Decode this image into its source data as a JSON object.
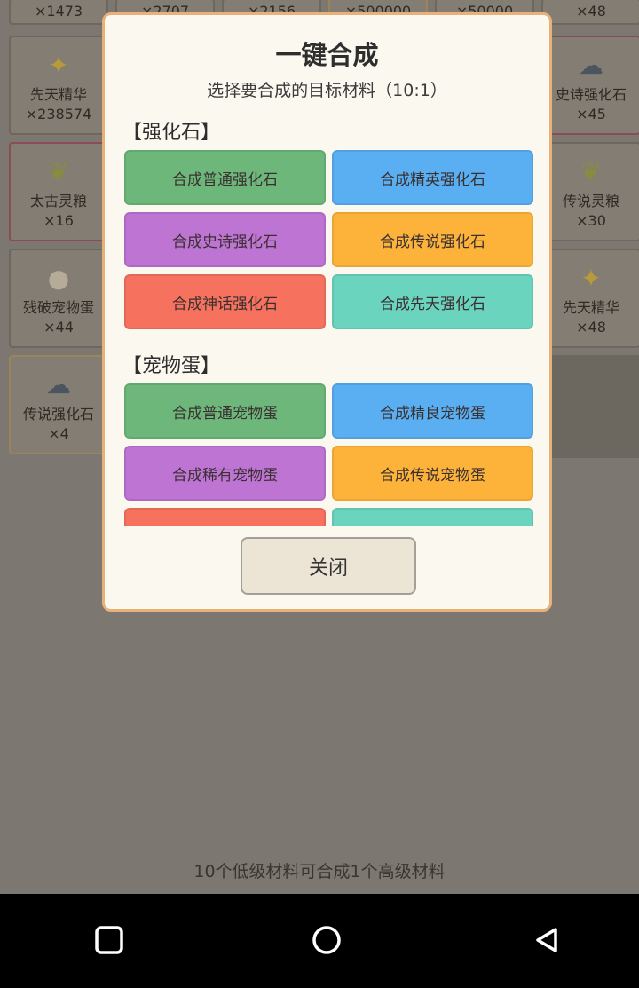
{
  "inventory": {
    "top_row": [
      "×1473",
      "×2707",
      "×2156",
      "×500000",
      "×50000",
      "×48"
    ],
    "left_items": [
      {
        "name": "先天精华",
        "count": "×238574",
        "icon": "sparkle-icon"
      },
      {
        "name": "太古灵粮",
        "count": "×16",
        "icon": "grain-icon"
      },
      {
        "name": "残破宠物蛋",
        "count": "×44",
        "icon": "egg-icon"
      },
      {
        "name": "传说强化石",
        "count": "×4",
        "icon": "stone-icon"
      }
    ],
    "right_items": [
      {
        "name": "史诗强化石",
        "count": "×45",
        "icon": "stone-icon"
      },
      {
        "name": "传说灵粮",
        "count": "×30",
        "icon": "grain-icon"
      },
      {
        "name": "先天精华",
        "count": "×48",
        "icon": "sparkle-icon"
      }
    ],
    "note": "10个低级材料可合成1个高级材料"
  },
  "dialog": {
    "title": "一键合成",
    "subtitle": "选择要合成的目标材料（10:1）",
    "sections": [
      {
        "title": "【强化石】",
        "buttons": [
          {
            "label": "合成普通强化石",
            "color": "#6db77b"
          },
          {
            "label": "合成精英强化石",
            "color": "#5aaef2"
          },
          {
            "label": "合成史诗强化石",
            "color": "#bd74d3"
          },
          {
            "label": "合成传说强化石",
            "color": "#fdb33a"
          },
          {
            "label": "合成神话强化石",
            "color": "#f6725f"
          },
          {
            "label": "合成先天强化石",
            "color": "#6bd4bf"
          }
        ]
      },
      {
        "title": "【宠物蛋】",
        "buttons": [
          {
            "label": "合成普通宠物蛋",
            "color": "#6db77b"
          },
          {
            "label": "合成精良宠物蛋",
            "color": "#5aaef2"
          },
          {
            "label": "合成稀有宠物蛋",
            "color": "#bd74d3"
          },
          {
            "label": "合成传说宠物蛋",
            "color": "#fdb33a"
          },
          {
            "label": "",
            "color": "#f6725f"
          },
          {
            "label": "",
            "color": "#6bd4bf"
          }
        ]
      }
    ],
    "close_label": "关闭"
  }
}
